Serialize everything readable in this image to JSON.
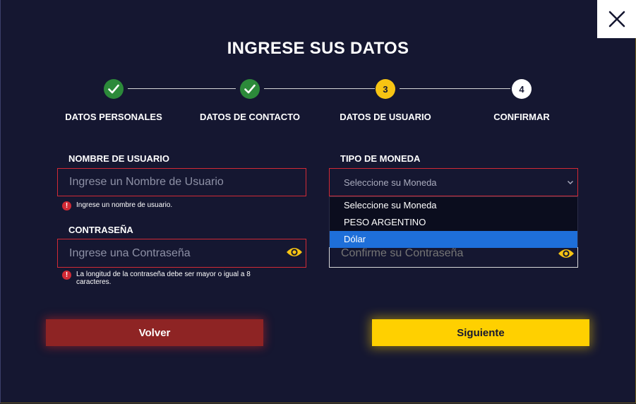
{
  "modal": {
    "title": "INGRESE SUS DATOS",
    "close_icon": "close-icon"
  },
  "stepper": {
    "steps": [
      {
        "label": "DATOS PERSONALES",
        "state": "done",
        "number": "1"
      },
      {
        "label": "DATOS DE CONTACTO",
        "state": "done",
        "number": "2"
      },
      {
        "label": "DATOS DE USUARIO",
        "state": "current",
        "number": "3"
      },
      {
        "label": "CONFIRMAR",
        "state": "pending",
        "number": "4"
      }
    ]
  },
  "form": {
    "username": {
      "label": "NOMBRE DE USUARIO",
      "placeholder": "Ingrese un Nombre de Usuario",
      "value": "",
      "error": "Ingrese un nombre de usuario."
    },
    "password": {
      "label": "CONTRASEÑA",
      "placeholder": "Ingrese una Contraseña",
      "value": "",
      "error": "La longitud de la contraseña debe ser mayor o igual a 8 caracteres."
    },
    "currency": {
      "label": "TIPO DE MONEDA",
      "selected": "Seleccione su Moneda",
      "options": [
        "Seleccione su Moneda",
        "PESO ARGENTINO",
        "Dólar"
      ],
      "highlighted_index": 2
    },
    "confirm_password": {
      "placeholder": "Confirme su Contraseña",
      "value": ""
    }
  },
  "buttons": {
    "back": "Volver",
    "next": "Siguiente"
  },
  "colors": {
    "background": "#151731",
    "accent": "#ffd000",
    "done": "#2c8a3a",
    "error": "#d12a35",
    "back_button": "#8e2424",
    "highlight": "#1e6fd9"
  }
}
